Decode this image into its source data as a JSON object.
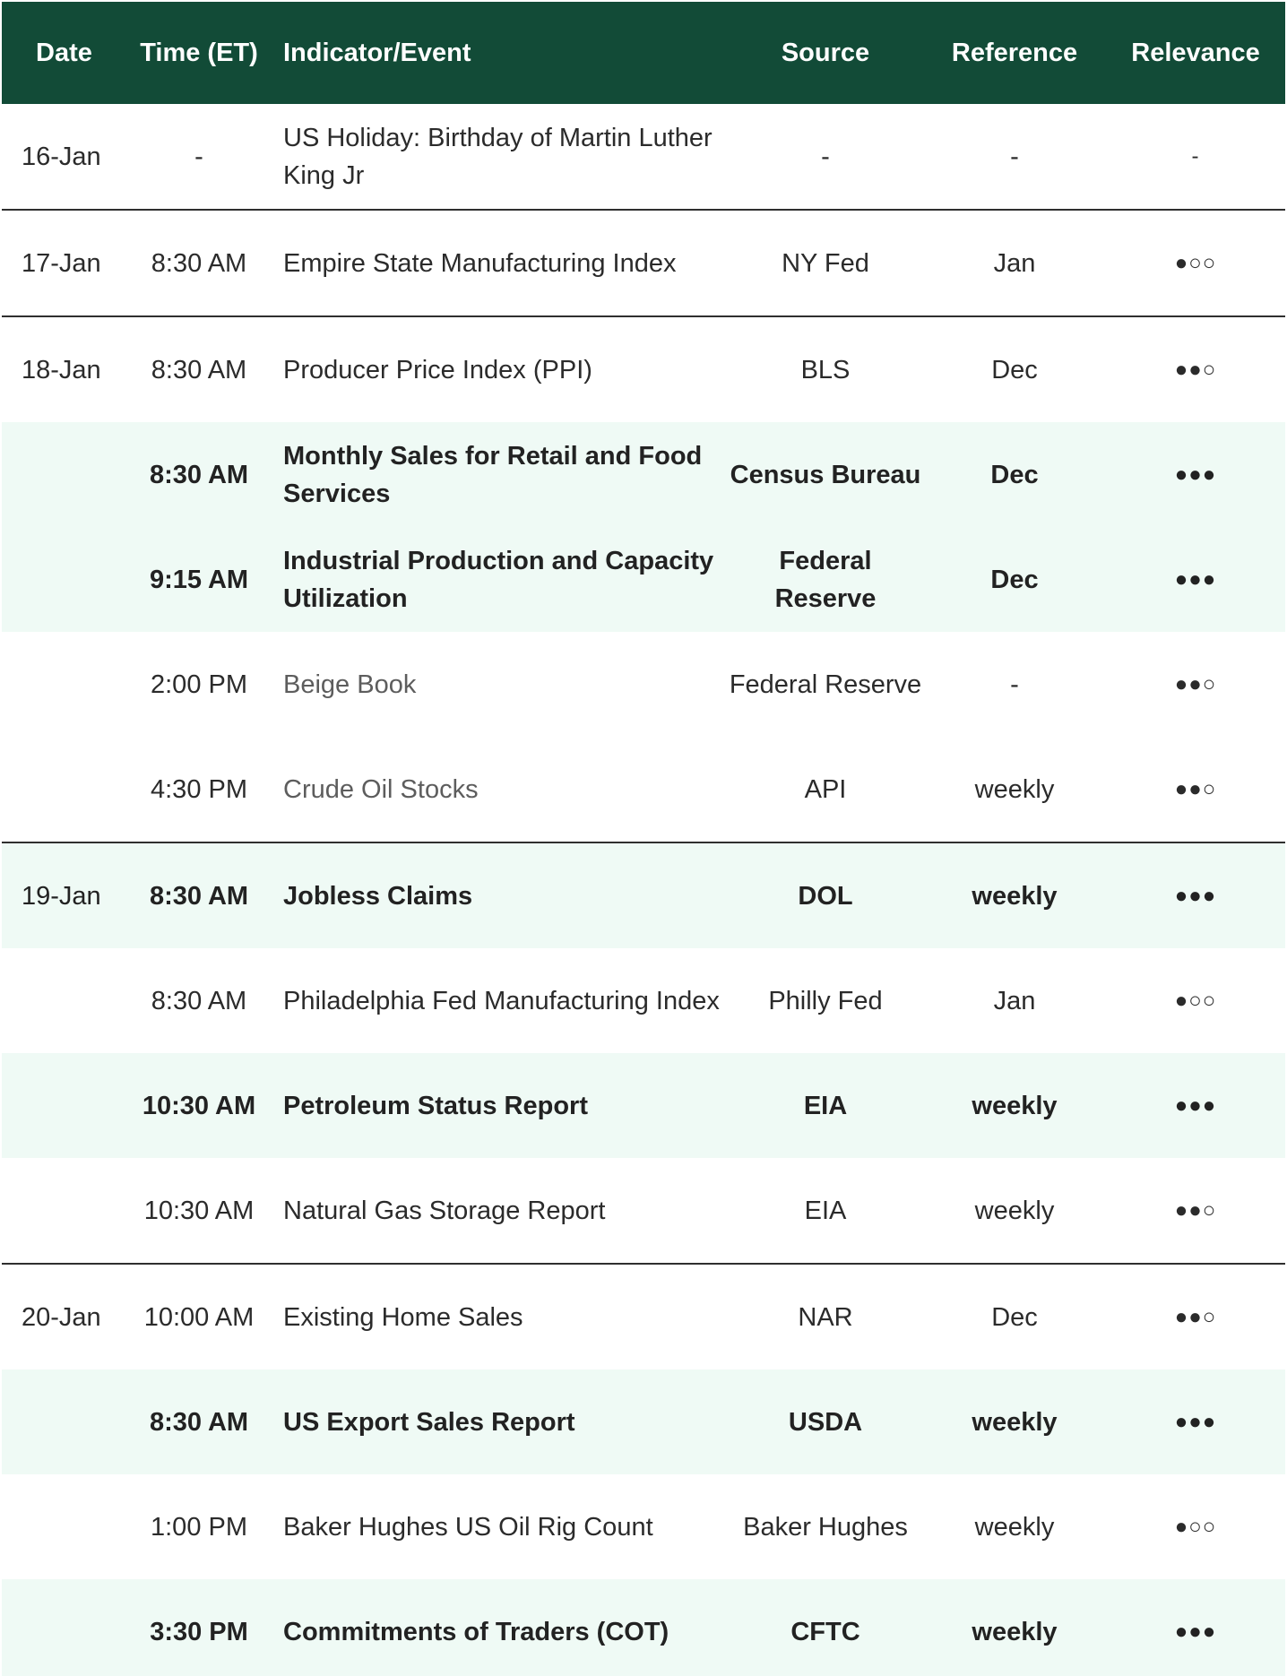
{
  "header": {
    "date": "Date",
    "time": "Time (ET)",
    "event": "Indicator/Event",
    "source": "Source",
    "reference": "Reference",
    "relevance": "Relevance"
  },
  "rows": [
    {
      "date": "16-Jan",
      "time": "-",
      "event": "US Holiday: Birthday of Martin Luther King Jr",
      "source": "-",
      "reference": "-",
      "relevance": "-"
    },
    {
      "date": "17-Jan",
      "time": "8:30 AM",
      "event": "Empire State Manufacturing Index",
      "source": "NY Fed",
      "reference": "Jan",
      "relevance": "●○○"
    },
    {
      "date": "18-Jan",
      "time": "8:30 AM",
      "event": "Producer Price Index (PPI)",
      "source": "BLS",
      "reference": "Dec",
      "relevance": "●●○"
    },
    {
      "date": "",
      "time": "8:30 AM",
      "event": "Monthly Sales for Retail and Food Services",
      "source": "Census Bureau",
      "reference": "Dec",
      "relevance": "●●●"
    },
    {
      "date": "",
      "time": "9:15 AM",
      "event": "Industrial Production and Capacity Utilization",
      "source": "Federal Reserve",
      "reference": "Dec",
      "relevance": "●●●"
    },
    {
      "date": "",
      "time": "2:00 PM",
      "event": "Beige Book",
      "source": "Federal Reserve",
      "reference": "-",
      "relevance": "●●○"
    },
    {
      "date": "",
      "time": "4:30 PM",
      "event": "Crude Oil Stocks",
      "source": "API",
      "reference": "weekly",
      "relevance": "●●○"
    },
    {
      "date": "19-Jan",
      "time": "8:30 AM",
      "event": "Jobless Claims",
      "source": "DOL",
      "reference": "weekly",
      "relevance": "●●●"
    },
    {
      "date": "",
      "time": "8:30 AM",
      "event": "Philadelphia Fed Manufacturing Index",
      "source": "Philly Fed",
      "reference": "Jan",
      "relevance": "●○○"
    },
    {
      "date": "",
      "time": "10:30 AM",
      "event": "Petroleum Status Report",
      "source": "EIA",
      "reference": "weekly",
      "relevance": "●●●"
    },
    {
      "date": "",
      "time": "10:30 AM",
      "event": "Natural Gas Storage Report",
      "source": "EIA",
      "reference": "weekly",
      "relevance": "●●○"
    },
    {
      "date": "20-Jan",
      "time": "10:00 AM",
      "event": "Existing Home Sales",
      "source": "NAR",
      "reference": "Dec",
      "relevance": "●●○"
    },
    {
      "date": "",
      "time": "8:30 AM",
      "event": "US Export Sales Report",
      "source": "USDA",
      "reference": "weekly",
      "relevance": "●●●"
    },
    {
      "date": "",
      "time": "1:00 PM",
      "event": "Baker Hughes US Oil Rig Count",
      "source": "Baker Hughes",
      "reference": "weekly",
      "relevance": "●○○"
    },
    {
      "date": "",
      "time": "3:30 PM",
      "event": "Commitments of Traders (COT)",
      "source": "CFTC",
      "reference": "weekly",
      "relevance": "●●●"
    }
  ],
  "colors": {
    "header_bg": "#124b37",
    "highlight_row_bg": "#effaf5",
    "separator": "#2f2f2f"
  }
}
